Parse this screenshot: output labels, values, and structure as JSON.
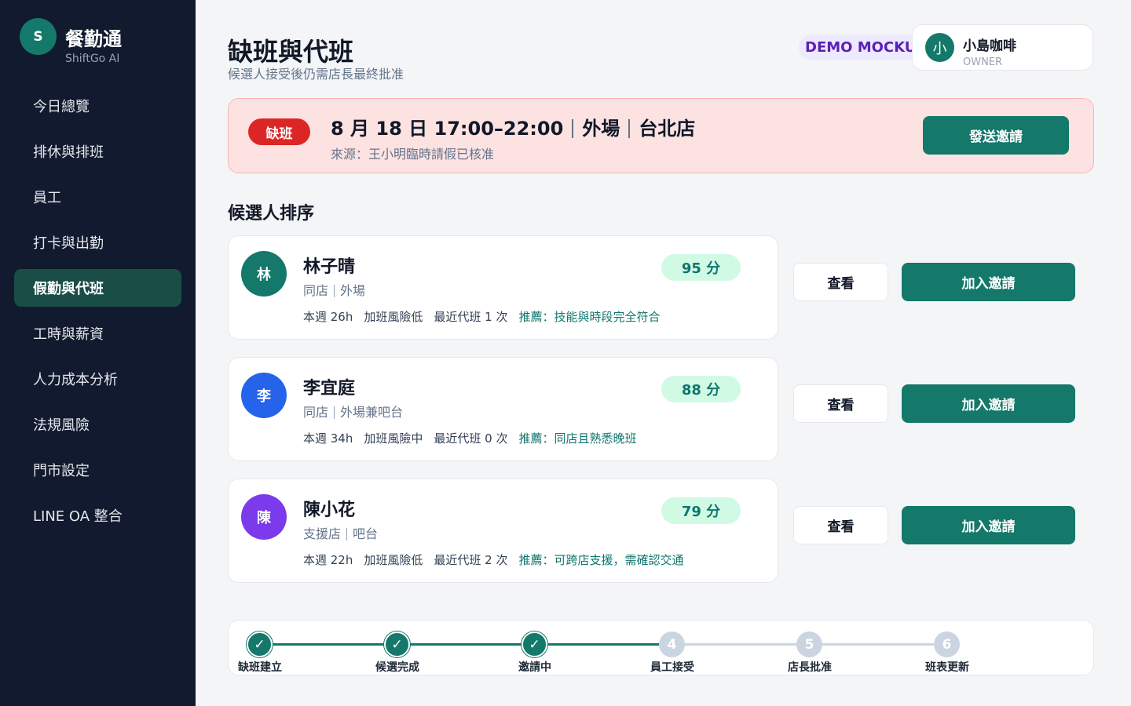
{
  "sidebar": {
    "logo_letter": "S",
    "app_name": "餐勤通",
    "app_sub": "ShiftGo AI",
    "items": [
      {
        "label": "今日總覽"
      },
      {
        "label": "排休與排班"
      },
      {
        "label": "員工"
      },
      {
        "label": "打卡與出勤"
      },
      {
        "label": "假勤與代班"
      },
      {
        "label": "工時與薪資"
      },
      {
        "label": "人力成本分析"
      },
      {
        "label": "法規風險"
      },
      {
        "label": "門市設定"
      },
      {
        "label": "LINE OA 整合"
      }
    ],
    "active_index": 4
  },
  "header": {
    "title": "缺班與代班",
    "subtitle": "候選人接受後仍需店長最終批准",
    "demo_badge": "DEMO MOCKUP",
    "user": {
      "avatar": "小",
      "name": "小島咖啡",
      "role": "OWNER"
    }
  },
  "alert": {
    "badge": "缺班",
    "date_time": "8 月 18 日 17:00–22:00",
    "area": "外場",
    "store": "台北店",
    "source": "來源：王小明臨時請假已核准",
    "send_label": "發送邀請"
  },
  "candidates_title": "候選人排序",
  "candidates": [
    {
      "avatar": "林",
      "avatar_color": "#14786a",
      "name": "林子晴",
      "store": "同店",
      "role": "外場",
      "hours": "本週 26h",
      "risk": "加班風險低",
      "recent": "最近代班 1 次",
      "reason": "推薦：技能與時段完全符合",
      "score": "95 分",
      "view_label": "查看",
      "invite_label": "加入邀請"
    },
    {
      "avatar": "李",
      "avatar_color": "#2563eb",
      "name": "李宜庭",
      "store": "同店",
      "role": "外場兼吧台",
      "hours": "本週 34h",
      "risk": "加班風險中",
      "recent": "最近代班 0 次",
      "reason": "推薦：同店且熟悉晚班",
      "score": "88 分",
      "view_label": "查看",
      "invite_label": "加入邀請"
    },
    {
      "avatar": "陳",
      "avatar_color": "#7c3aed",
      "name": "陳小花",
      "store": "支援店",
      "role": "吧台",
      "hours": "本週 22h",
      "risk": "加班風險低",
      "recent": "最近代班 2 次",
      "reason": "推薦：可跨店支援，需確認交通",
      "score": "79 分",
      "view_label": "查看",
      "invite_label": "加入邀請"
    }
  ],
  "stepper": {
    "steps": [
      {
        "num": "✓",
        "label": "缺班建立",
        "done": true
      },
      {
        "num": "✓",
        "label": "候選完成",
        "done": true
      },
      {
        "num": "✓",
        "label": "邀請中",
        "done": true
      },
      {
        "num": "4",
        "label": "員工接受",
        "done": false
      },
      {
        "num": "5",
        "label": "店長批准",
        "done": false
      },
      {
        "num": "6",
        "label": "班表更新",
        "done": false
      }
    ]
  },
  "colors": {
    "primary": "#14786a",
    "sidebar_bg": "#111a2e",
    "alert_bg": "#fde2e2",
    "danger": "#dc2626"
  }
}
